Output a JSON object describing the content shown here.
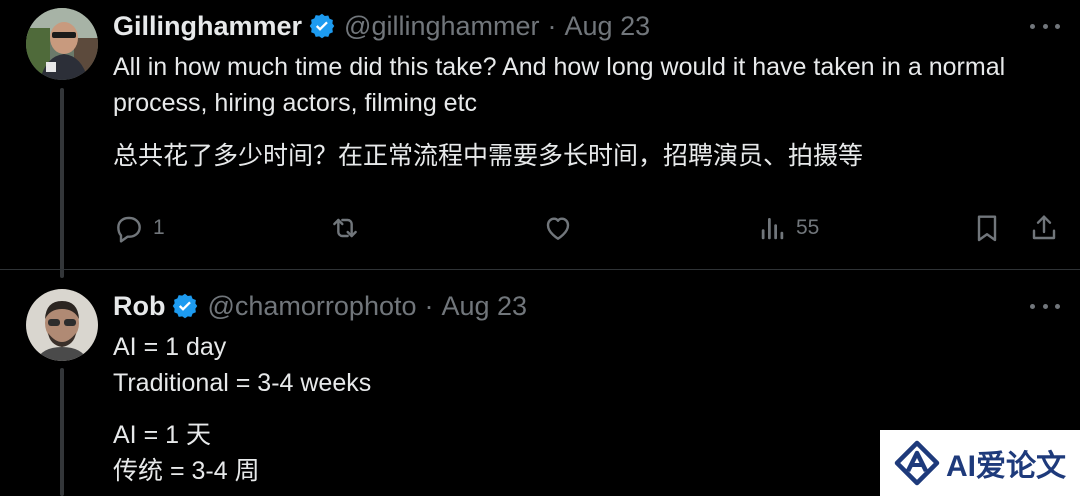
{
  "colors": {
    "background": "#000000",
    "text": "#e7e9ea",
    "muted": "#71767b",
    "verified": "#1d9bf0",
    "thread_line": "#333639",
    "watermark_brand": "#1e3a7b"
  },
  "tweet1": {
    "name": "Gillinghammer",
    "handle": "@gillinghammer",
    "separator": "·",
    "date": "Aug 23",
    "text_en": "All in how much time did this take? And how long would it have taken in a normal process, hiring actors, filming etc",
    "text_zh": "总共花了多少时间？在正常流程中需要多长时间，招聘演员、拍摄等",
    "actions": {
      "replies": "1",
      "retweets": "",
      "likes": "",
      "views": "55"
    },
    "icons": [
      "verified-badge-icon",
      "more-icon",
      "reply-icon",
      "retweet-icon",
      "like-icon",
      "views-icon",
      "bookmark-icon",
      "share-icon"
    ]
  },
  "tweet2": {
    "name": "Rob",
    "handle": "@chamorrophoto",
    "separator": "·",
    "date": "Aug 23",
    "text_en": "AI = 1 day\nTraditional = 3-4 weeks",
    "text_zh": "AI = 1 天\n传统 = 3-4 周",
    "icons": [
      "verified-badge-icon",
      "more-icon"
    ]
  },
  "watermark": {
    "text": "AI爱论文"
  }
}
